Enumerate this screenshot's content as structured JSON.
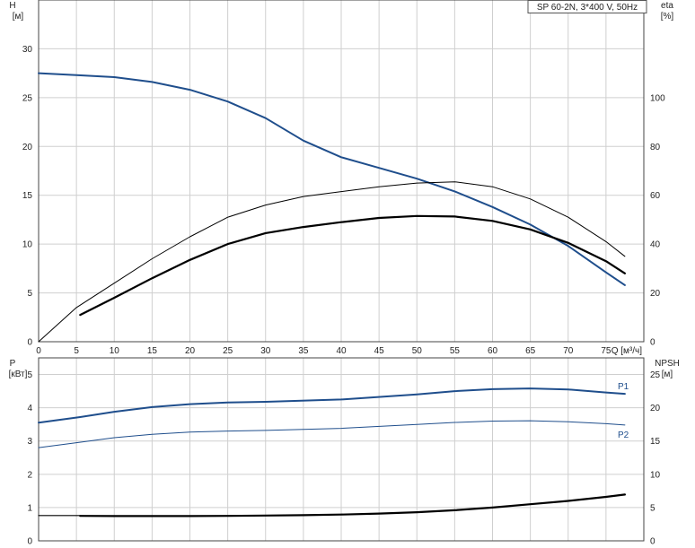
{
  "chart_data": [
    {
      "type": "line",
      "title": "SP 60-2N, 3*400 V, 50Hz",
      "x_axis": {
        "label": "Q [м³/ч]",
        "range": [
          0,
          80
        ],
        "ticks": [
          0,
          5,
          10,
          15,
          20,
          25,
          30,
          35,
          40,
          45,
          50,
          55,
          60,
          65,
          70,
          75
        ],
        "grid": true
      },
      "y_left": {
        "label": "H",
        "unit": "[м]",
        "range": [
          0,
          35
        ],
        "ticks": [
          0,
          5,
          10,
          15,
          20,
          25,
          30
        ]
      },
      "y_right": {
        "label": "eta",
        "unit": "[%]",
        "range": [
          0,
          140
        ],
        "ticks": [
          0,
          20,
          40,
          60,
          80,
          100
        ]
      },
      "series": [
        {
          "axis": "left",
          "color": "#1f4e8c",
          "width": 2,
          "points": [
            [
              0,
              27.5
            ],
            [
              5,
              27.3
            ],
            [
              10,
              27.1
            ],
            [
              15,
              26.6
            ],
            [
              20,
              25.8
            ],
            [
              25,
              24.6
            ],
            [
              30,
              22.9
            ],
            [
              35,
              20.6
            ],
            [
              40,
              18.9
            ],
            [
              45,
              17.8
            ],
            [
              50,
              16.7
            ],
            [
              55,
              15.4
            ],
            [
              60,
              13.8
            ],
            [
              65,
              12.0
            ],
            [
              70,
              9.8
            ],
            [
              75,
              7.1
            ],
            [
              77.5,
              5.8
            ]
          ]
        },
        {
          "axis": "right",
          "color": "#000000",
          "width": 1,
          "points": [
            [
              0,
              0
            ],
            [
              5,
              14
            ],
            [
              10,
              24
            ],
            [
              15,
              34
            ],
            [
              20,
              43
            ],
            [
              25,
              51
            ],
            [
              30,
              56
            ],
            [
              35,
              59.5
            ],
            [
              40,
              61.5
            ],
            [
              45,
              63.5
            ],
            [
              50,
              65
            ],
            [
              55,
              65.5
            ],
            [
              60,
              63.5
            ],
            [
              65,
              58.5
            ],
            [
              70,
              51
            ],
            [
              75,
              41
            ],
            [
              77.5,
              35
            ]
          ]
        },
        {
          "axis": "right",
          "color": "#000000",
          "width": 2.2,
          "points": [
            [
              5.5,
              11
            ],
            [
              10,
              18
            ],
            [
              15,
              26
            ],
            [
              20,
              33.5
            ],
            [
              25,
              40
            ],
            [
              30,
              44.5
            ],
            [
              35,
              47
            ],
            [
              40,
              49
            ],
            [
              45,
              50.7
            ],
            [
              50,
              51.5
            ],
            [
              55,
              51.3
            ],
            [
              60,
              49.5
            ],
            [
              65,
              46
            ],
            [
              70,
              40.5
            ],
            [
              75,
              33
            ],
            [
              77.5,
              28
            ]
          ]
        }
      ]
    },
    {
      "type": "line",
      "x_axis": {
        "range": [
          0,
          80
        ],
        "ticks": [
          0,
          5,
          10,
          15,
          20,
          25,
          30,
          35,
          40,
          45,
          50,
          55,
          60,
          65,
          70,
          75
        ],
        "grid": true
      },
      "y_left": {
        "label": "P",
        "unit": "[кВт]",
        "range": [
          0,
          5.5
        ],
        "ticks": [
          0,
          1,
          2,
          3,
          4,
          5
        ]
      },
      "y_right": {
        "label": "NPSH",
        "unit": "[м]",
        "range": [
          0,
          27.5
        ],
        "ticks": [
          0,
          5,
          10,
          15,
          20,
          25
        ]
      },
      "series": [
        {
          "name": "P1",
          "axis": "left",
          "color": "#1f4e8c",
          "width": 2,
          "points": [
            [
              0,
              3.55
            ],
            [
              5.5,
              3.72
            ],
            [
              10,
              3.88
            ],
            [
              15,
              4.02
            ],
            [
              20,
              4.11
            ],
            [
              25,
              4.16
            ],
            [
              30,
              4.18
            ],
            [
              40,
              4.25
            ],
            [
              50,
              4.4
            ],
            [
              55,
              4.5
            ],
            [
              60,
              4.56
            ],
            [
              65,
              4.58
            ],
            [
              70,
              4.55
            ],
            [
              75,
              4.46
            ],
            [
              77.5,
              4.42
            ]
          ],
          "label": "P1"
        },
        {
          "name": "P2",
          "axis": "left",
          "color": "#1f4e8c",
          "width": 1,
          "points": [
            [
              0,
              2.8
            ],
            [
              5,
              2.95
            ],
            [
              10,
              3.1
            ],
            [
              15,
              3.2
            ],
            [
              20,
              3.27
            ],
            [
              25,
              3.3
            ],
            [
              30,
              3.32
            ],
            [
              40,
              3.38
            ],
            [
              50,
              3.5
            ],
            [
              55,
              3.56
            ],
            [
              60,
              3.6
            ],
            [
              65,
              3.61
            ],
            [
              70,
              3.58
            ],
            [
              75,
              3.52
            ],
            [
              77.5,
              3.48
            ]
          ],
          "label": "P2"
        },
        {
          "axis": "right",
          "color": "#000000",
          "width": 1.2,
          "points": [
            [
              0,
              3.8
            ],
            [
              5.5,
              3.8
            ]
          ]
        },
        {
          "axis": "right",
          "color": "#000000",
          "width": 2.2,
          "points": [
            [
              5.5,
              3.75
            ],
            [
              10,
              3.72
            ],
            [
              15,
              3.72
            ],
            [
              20,
              3.72
            ],
            [
              25,
              3.75
            ],
            [
              30,
              3.8
            ],
            [
              35,
              3.85
            ],
            [
              40,
              3.95
            ],
            [
              45,
              4.1
            ],
            [
              50,
              4.3
            ],
            [
              55,
              4.6
            ],
            [
              60,
              5.0
            ],
            [
              65,
              5.5
            ],
            [
              70,
              6.0
            ],
            [
              75,
              6.6
            ],
            [
              77.5,
              6.95
            ]
          ]
        }
      ]
    }
  ]
}
